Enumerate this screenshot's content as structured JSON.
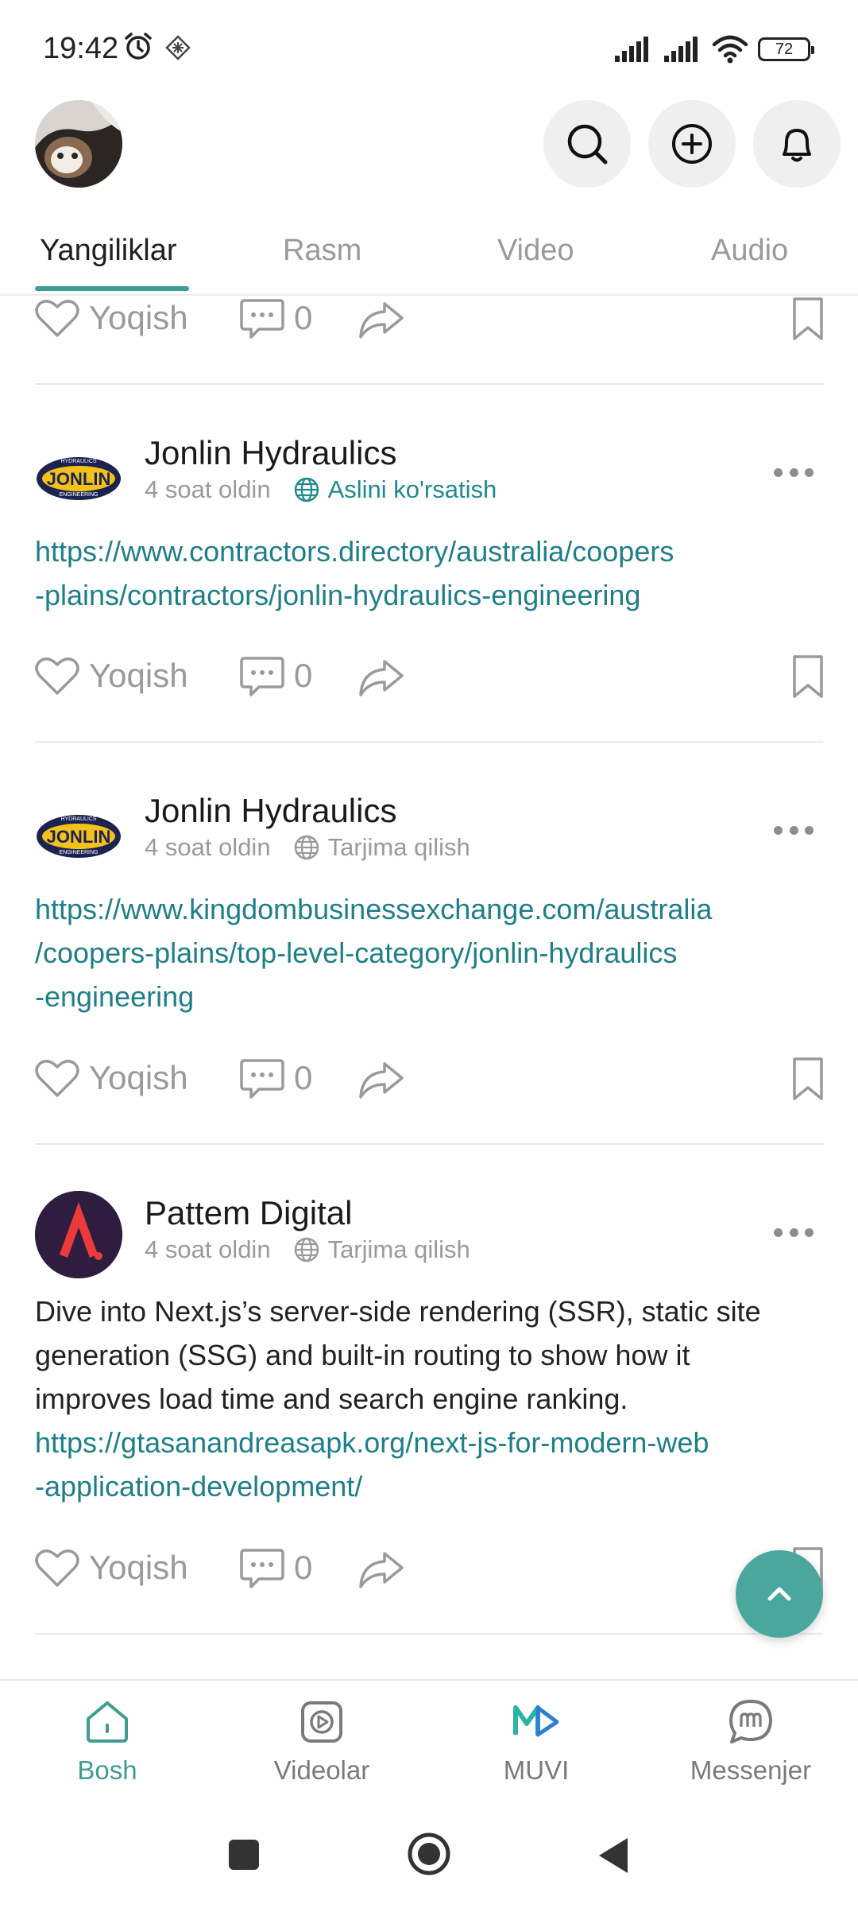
{
  "status_bar": {
    "time": "19:42",
    "battery": "72"
  },
  "tabs": [
    {
      "label": "Yangiliklar",
      "active": true
    },
    {
      "label": "Rasm",
      "active": false
    },
    {
      "label": "Video",
      "active": false
    },
    {
      "label": "Audio",
      "active": false
    }
  ],
  "actions": {
    "like_label": "Yoqish"
  },
  "posts": [
    {
      "comments": "0"
    },
    {
      "author": "Jonlin Hydraulics",
      "time": "4 soat oldin",
      "translate_label": "Aslini ko'rsatish",
      "link_lines": [
        "https://www.contractors.directory/australia/coopers",
        "-plains/contractors/jonlin-hydraulics-engineering"
      ],
      "comments": "0"
    },
    {
      "author": "Jonlin Hydraulics",
      "time": "4 soat oldin",
      "translate_label": "Tarjima qilish",
      "link_lines": [
        "https://www.kingdombusinessexchange.com/australia",
        "/coopers-plains/top-level-category/jonlin-hydraulics",
        "-engineering"
      ],
      "comments": "0"
    },
    {
      "author": "Pattem Digital",
      "time": "4 soat oldin",
      "translate_label": "Tarjima qilish",
      "text_lines": [
        "Dive into Next.js’s server-side rendering (SSR), static site",
        "generation (SSG) and built-in routing to show how it",
        "improves load time and search engine ranking."
      ],
      "link_lines": [
        "https://gtasanandreasapk.org/next-js-for-modern-web",
        "-application-development/"
      ],
      "comments": "0"
    }
  ],
  "logo_text": {
    "jonlin_top": "HYDRAULICS",
    "jonlin_main": "JONLIN",
    "jonlin_bottom": "ENGINEERING"
  },
  "bottom_nav": [
    {
      "label": "Bosh",
      "active": true
    },
    {
      "label": "Videolar",
      "active": false
    },
    {
      "label": "MUVI",
      "active": false
    },
    {
      "label": "Messenjer",
      "active": false
    }
  ],
  "colors": {
    "accent": "#3e9e96",
    "link": "#1e7f89",
    "muvi_green": "#2bb3a3",
    "muvi_blue": "#2f7fd0"
  }
}
